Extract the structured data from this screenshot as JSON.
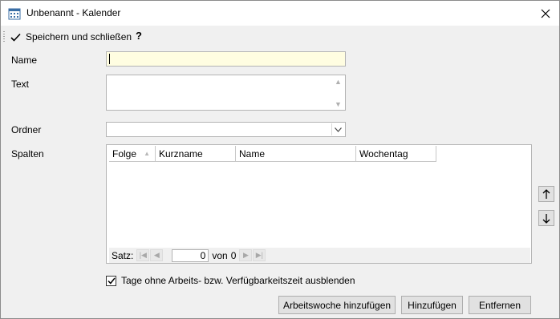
{
  "window": {
    "title": "Unbenannt - Kalender",
    "title_icon": "calendar-icon",
    "close_icon": "close-icon"
  },
  "toolbar": {
    "save_close_label": "Speichern und schließen",
    "help_label": "?"
  },
  "form": {
    "name_label": "Name",
    "name_value": "",
    "text_label": "Text",
    "text_value": "",
    "folder_label": "Ordner",
    "folder_value": "",
    "columns_label": "Spalten"
  },
  "grid": {
    "columns": [
      "Folge",
      "Kurzname",
      "Name",
      "Wochentag"
    ],
    "rows": [],
    "navigator": {
      "record_label": "Satz:",
      "current": "0",
      "of_label": "von",
      "total": "0"
    }
  },
  "checkbox": {
    "label": "Tage ohne Arbeits- bzw. Verfügbarkeitszeit ausblenden",
    "checked": true
  },
  "buttons": {
    "add_workweek": "Arbeitswoche hinzufügen",
    "add": "Hinzufügen",
    "remove": "Entfernen"
  },
  "colors": {
    "name_field_bg": "#fffde1",
    "window_bg": "#f0f0f0",
    "button_bg": "#e1e1e1"
  }
}
